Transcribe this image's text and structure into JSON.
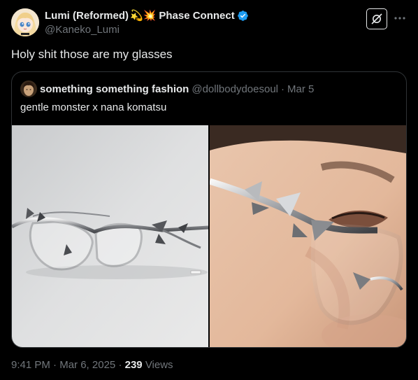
{
  "author": {
    "display_name": "Lumi (Reformed)",
    "name_emojis": "💫💥",
    "affiliation": "Phase Connect",
    "handle": "@Kaneko_Lumi",
    "verified_color": "#1d9bf0",
    "avatar_icon": "anime-girl-avatar"
  },
  "actions": {
    "grok_icon": "grok-icon",
    "more_icon": "more-options-icon"
  },
  "tweet": {
    "text": "Holy shit those are my glasses"
  },
  "quote": {
    "display_name": "something something fashion",
    "handle": "@dollbodydoesoul",
    "separator": "·",
    "date": "Mar 5",
    "text": "gentle monster x nana komatsu",
    "images": [
      {
        "description_icon": "silver-spiked-glasses-photo"
      },
      {
        "description_icon": "model-wearing-glasses-photo"
      }
    ]
  },
  "meta": {
    "time": "9:41 PM",
    "separator": "·",
    "date": "Mar 6, 2025",
    "views_count": "239",
    "views_label": "Views"
  },
  "colors": {
    "background": "#000000",
    "text_primary": "#e7e9ea",
    "text_secondary": "#71767b",
    "border": "#2f3336"
  }
}
